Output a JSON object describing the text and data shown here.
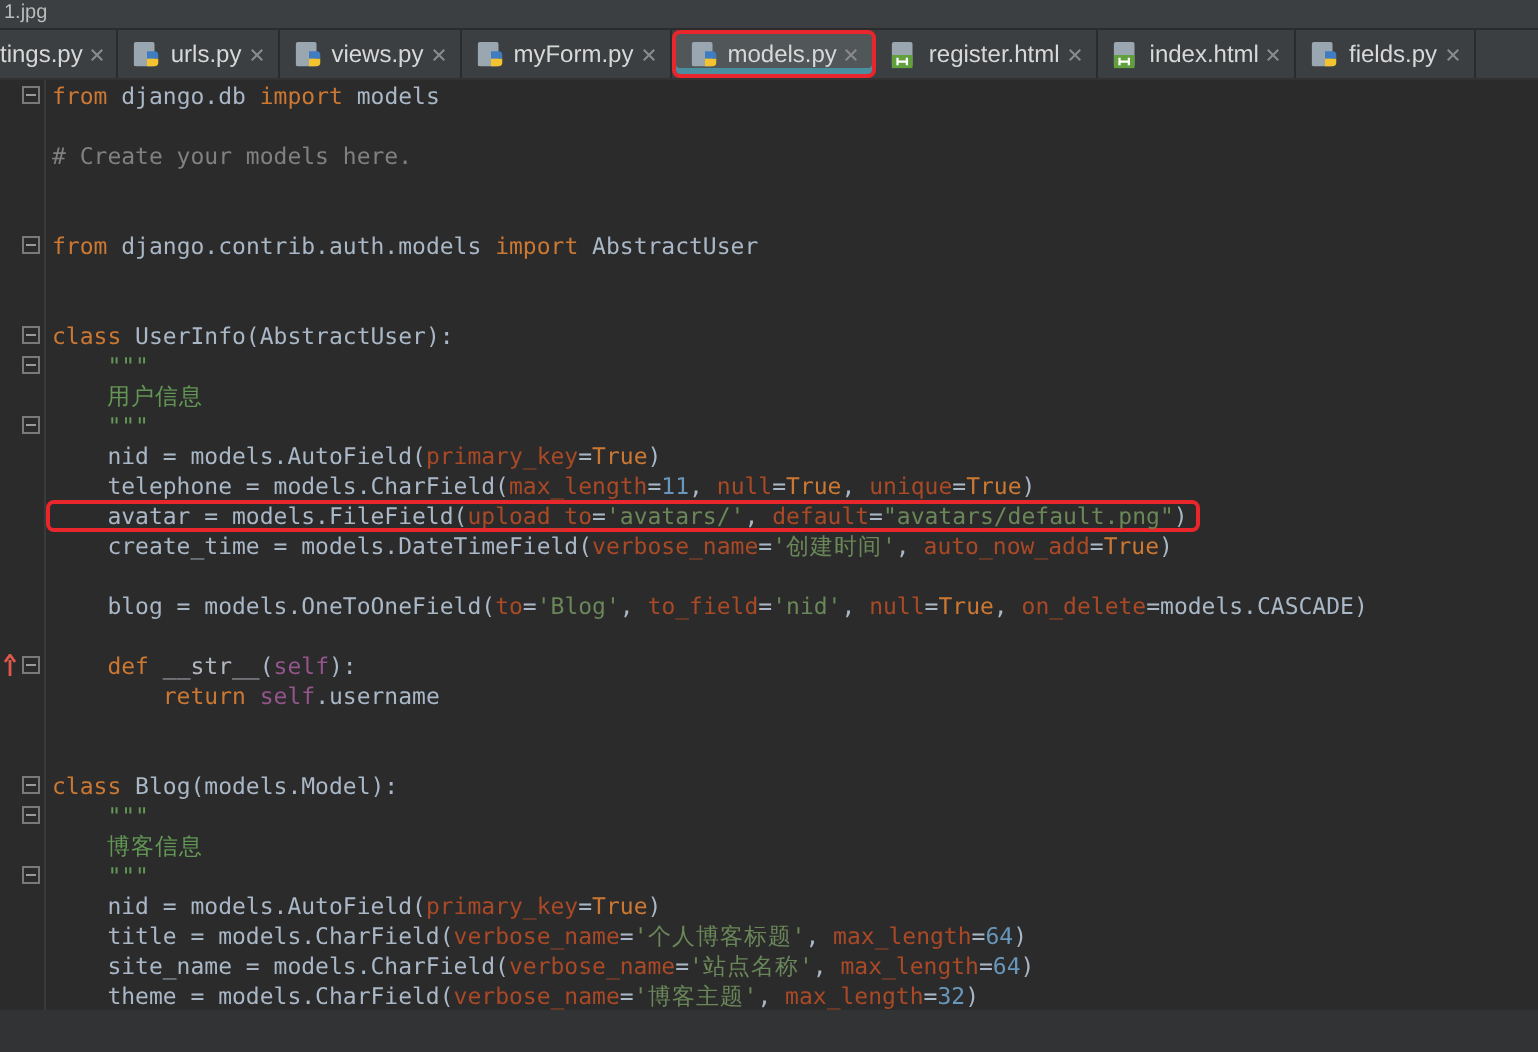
{
  "breadcrumb": "1.jpg",
  "tabs": [
    {
      "label": "tings.py",
      "kind": "partial",
      "selected": false,
      "highlighted": false
    },
    {
      "label": "urls.py",
      "kind": "py",
      "selected": false,
      "highlighted": false
    },
    {
      "label": "views.py",
      "kind": "py",
      "selected": false,
      "highlighted": false
    },
    {
      "label": "myForm.py",
      "kind": "py",
      "selected": false,
      "highlighted": false
    },
    {
      "label": "models.py",
      "kind": "py",
      "selected": true,
      "highlighted": true
    },
    {
      "label": "register.html",
      "kind": "html",
      "selected": false,
      "highlighted": false
    },
    {
      "label": "index.html",
      "kind": "html",
      "selected": false,
      "highlighted": false
    },
    {
      "label": "fields.py",
      "kind": "py",
      "selected": false,
      "highlighted": false
    }
  ],
  "lines": [
    {
      "kind": "code",
      "fold": true,
      "override": false,
      "highlighted": false,
      "tokens": [
        {
          "kind": "kw",
          "text": "from"
        },
        {
          "kind": "plain",
          "text": " django.db "
        },
        {
          "kind": "kw",
          "text": "import"
        },
        {
          "kind": "plain",
          "text": " models"
        }
      ]
    },
    {
      "kind": "blank"
    },
    {
      "kind": "code",
      "fold": false,
      "override": false,
      "highlighted": false,
      "tokens": [
        {
          "kind": "comment",
          "text": "# Create your models here."
        }
      ]
    },
    {
      "kind": "blank"
    },
    {
      "kind": "blank"
    },
    {
      "kind": "code",
      "fold": true,
      "override": false,
      "highlighted": false,
      "tokens": [
        {
          "kind": "kw",
          "text": "from"
        },
        {
          "kind": "plain",
          "text": " django.contrib.auth.models "
        },
        {
          "kind": "kw",
          "text": "import"
        },
        {
          "kind": "plain",
          "text": " AbstractUser"
        }
      ]
    },
    {
      "kind": "blank"
    },
    {
      "kind": "blank"
    },
    {
      "kind": "code",
      "fold": true,
      "override": false,
      "highlighted": false,
      "tokens": [
        {
          "kind": "kw",
          "text": "class"
        },
        {
          "kind": "plain",
          "text": " UserInfo(AbstractUser):"
        }
      ]
    },
    {
      "kind": "code",
      "fold": true,
      "override": false,
      "highlighted": false,
      "tokens": [
        {
          "kind": "doc",
          "text": "    \"\"\""
        }
      ]
    },
    {
      "kind": "code",
      "fold": false,
      "override": false,
      "highlighted": false,
      "tokens": [
        {
          "kind": "doc",
          "text": "    用户信息"
        }
      ]
    },
    {
      "kind": "code",
      "fold": true,
      "override": false,
      "highlighted": false,
      "tokens": [
        {
          "kind": "doc",
          "text": "    \"\"\""
        }
      ]
    },
    {
      "kind": "code",
      "fold": false,
      "override": false,
      "highlighted": false,
      "tokens": [
        {
          "kind": "plain",
          "text": "    nid = models.AutoField("
        },
        {
          "kind": "param",
          "text": "primary_key"
        },
        {
          "kind": "plain",
          "text": "="
        },
        {
          "kind": "kw",
          "text": "True"
        },
        {
          "kind": "plain",
          "text": ")"
        }
      ]
    },
    {
      "kind": "code",
      "fold": false,
      "override": false,
      "highlighted": false,
      "tokens": [
        {
          "kind": "plain",
          "text": "    telephone = models.CharField("
        },
        {
          "kind": "param",
          "text": "max_length"
        },
        {
          "kind": "plain",
          "text": "="
        },
        {
          "kind": "num",
          "text": "11"
        },
        {
          "kind": "plain",
          "text": ", "
        },
        {
          "kind": "param",
          "text": "null"
        },
        {
          "kind": "plain",
          "text": "="
        },
        {
          "kind": "kw",
          "text": "True"
        },
        {
          "kind": "plain",
          "text": ", "
        },
        {
          "kind": "param",
          "text": "unique"
        },
        {
          "kind": "plain",
          "text": "="
        },
        {
          "kind": "kw",
          "text": "True"
        },
        {
          "kind": "plain",
          "text": ")"
        }
      ]
    },
    {
      "kind": "code",
      "fold": false,
      "override": false,
      "highlighted": true,
      "tokens": [
        {
          "kind": "plain",
          "text": "    avatar = models.FileField("
        },
        {
          "kind": "param",
          "text": "upload_to"
        },
        {
          "kind": "plain",
          "text": "="
        },
        {
          "kind": "str",
          "text": "'avatars/'"
        },
        {
          "kind": "plain",
          "text": ", "
        },
        {
          "kind": "param",
          "text": "default"
        },
        {
          "kind": "plain",
          "text": "="
        },
        {
          "kind": "str",
          "text": "\"avatars/default.png\""
        },
        {
          "kind": "plain",
          "text": ")"
        }
      ]
    },
    {
      "kind": "code",
      "fold": false,
      "override": false,
      "highlighted": false,
      "tokens": [
        {
          "kind": "plain",
          "text": "    create_time = models.DateTimeField("
        },
        {
          "kind": "param",
          "text": "verbose_name"
        },
        {
          "kind": "plain",
          "text": "="
        },
        {
          "kind": "str",
          "text": "'创建时间'"
        },
        {
          "kind": "plain",
          "text": ", "
        },
        {
          "kind": "param",
          "text": "auto_now_add"
        },
        {
          "kind": "plain",
          "text": "="
        },
        {
          "kind": "kw",
          "text": "True"
        },
        {
          "kind": "plain",
          "text": ")"
        }
      ]
    },
    {
      "kind": "blank"
    },
    {
      "kind": "code",
      "fold": false,
      "override": false,
      "highlighted": false,
      "tokens": [
        {
          "kind": "plain",
          "text": "    blog = models.OneToOneField("
        },
        {
          "kind": "param",
          "text": "to"
        },
        {
          "kind": "plain",
          "text": "="
        },
        {
          "kind": "str",
          "text": "'Blog'"
        },
        {
          "kind": "plain",
          "text": ", "
        },
        {
          "kind": "param",
          "text": "to_field"
        },
        {
          "kind": "plain",
          "text": "="
        },
        {
          "kind": "str",
          "text": "'nid'"
        },
        {
          "kind": "plain",
          "text": ", "
        },
        {
          "kind": "param",
          "text": "null"
        },
        {
          "kind": "plain",
          "text": "="
        },
        {
          "kind": "kw",
          "text": "True"
        },
        {
          "kind": "plain",
          "text": ", "
        },
        {
          "kind": "param",
          "text": "on_delete"
        },
        {
          "kind": "plain",
          "text": "=models.CASCADE)"
        }
      ]
    },
    {
      "kind": "blank"
    },
    {
      "kind": "code",
      "fold": true,
      "override": true,
      "highlighted": false,
      "tokens": [
        {
          "kind": "kw",
          "text": "    def"
        },
        {
          "kind": "magic",
          "text": " __str__"
        },
        {
          "kind": "plain",
          "text": "("
        },
        {
          "kind": "self",
          "text": "self"
        },
        {
          "kind": "plain",
          "text": "):"
        }
      ]
    },
    {
      "kind": "code",
      "fold": false,
      "override": false,
      "highlighted": false,
      "tokens": [
        {
          "kind": "kw",
          "text": "        return"
        },
        {
          "kind": "self",
          "text": " self"
        },
        {
          "kind": "plain",
          "text": ".username"
        }
      ]
    },
    {
      "kind": "blank"
    },
    {
      "kind": "blank"
    },
    {
      "kind": "code",
      "fold": true,
      "override": false,
      "highlighted": false,
      "tokens": [
        {
          "kind": "kw",
          "text": "class"
        },
        {
          "kind": "plain",
          "text": " Blog(models.Model):"
        }
      ]
    },
    {
      "kind": "code",
      "fold": true,
      "override": false,
      "highlighted": false,
      "tokens": [
        {
          "kind": "doc",
          "text": "    \"\"\""
        }
      ]
    },
    {
      "kind": "code",
      "fold": false,
      "override": false,
      "highlighted": false,
      "tokens": [
        {
          "kind": "doc",
          "text": "    博客信息"
        }
      ]
    },
    {
      "kind": "code",
      "fold": true,
      "override": false,
      "highlighted": false,
      "tokens": [
        {
          "kind": "doc",
          "text": "    \"\"\""
        }
      ]
    },
    {
      "kind": "code",
      "fold": false,
      "override": false,
      "highlighted": false,
      "tokens": [
        {
          "kind": "plain",
          "text": "    nid = models.AutoField("
        },
        {
          "kind": "param",
          "text": "primary_key"
        },
        {
          "kind": "plain",
          "text": "="
        },
        {
          "kind": "kw",
          "text": "True"
        },
        {
          "kind": "plain",
          "text": ")"
        }
      ]
    },
    {
      "kind": "code",
      "fold": false,
      "override": false,
      "highlighted": false,
      "tokens": [
        {
          "kind": "plain",
          "text": "    title = models.CharField("
        },
        {
          "kind": "param",
          "text": "verbose_name"
        },
        {
          "kind": "plain",
          "text": "="
        },
        {
          "kind": "str",
          "text": "'个人博客标题'"
        },
        {
          "kind": "plain",
          "text": ", "
        },
        {
          "kind": "param",
          "text": "max_length"
        },
        {
          "kind": "plain",
          "text": "="
        },
        {
          "kind": "num",
          "text": "64"
        },
        {
          "kind": "plain",
          "text": ")"
        }
      ]
    },
    {
      "kind": "code",
      "fold": false,
      "override": false,
      "highlighted": false,
      "tokens": [
        {
          "kind": "plain",
          "text": "    site_name = models.CharField("
        },
        {
          "kind": "param",
          "text": "verbose_name"
        },
        {
          "kind": "plain",
          "text": "="
        },
        {
          "kind": "str",
          "text": "'站点名称'"
        },
        {
          "kind": "plain",
          "text": ", "
        },
        {
          "kind": "param",
          "text": "max_length"
        },
        {
          "kind": "plain",
          "text": "="
        },
        {
          "kind": "num",
          "text": "64"
        },
        {
          "kind": "plain",
          "text": ")"
        }
      ]
    },
    {
      "kind": "code",
      "fold": false,
      "override": false,
      "highlighted": false,
      "tokens": [
        {
          "kind": "plain",
          "text": "    theme = models.CharField("
        },
        {
          "kind": "param",
          "text": "verbose_name"
        },
        {
          "kind": "plain",
          "text": "="
        },
        {
          "kind": "str",
          "text": "'博客主题'"
        },
        {
          "kind": "plain",
          "text": ", "
        },
        {
          "kind": "param",
          "text": "max_length"
        },
        {
          "kind": "plain",
          "text": "="
        },
        {
          "kind": "num",
          "text": "32"
        },
        {
          "kind": "plain",
          "text": ")"
        }
      ]
    }
  ]
}
